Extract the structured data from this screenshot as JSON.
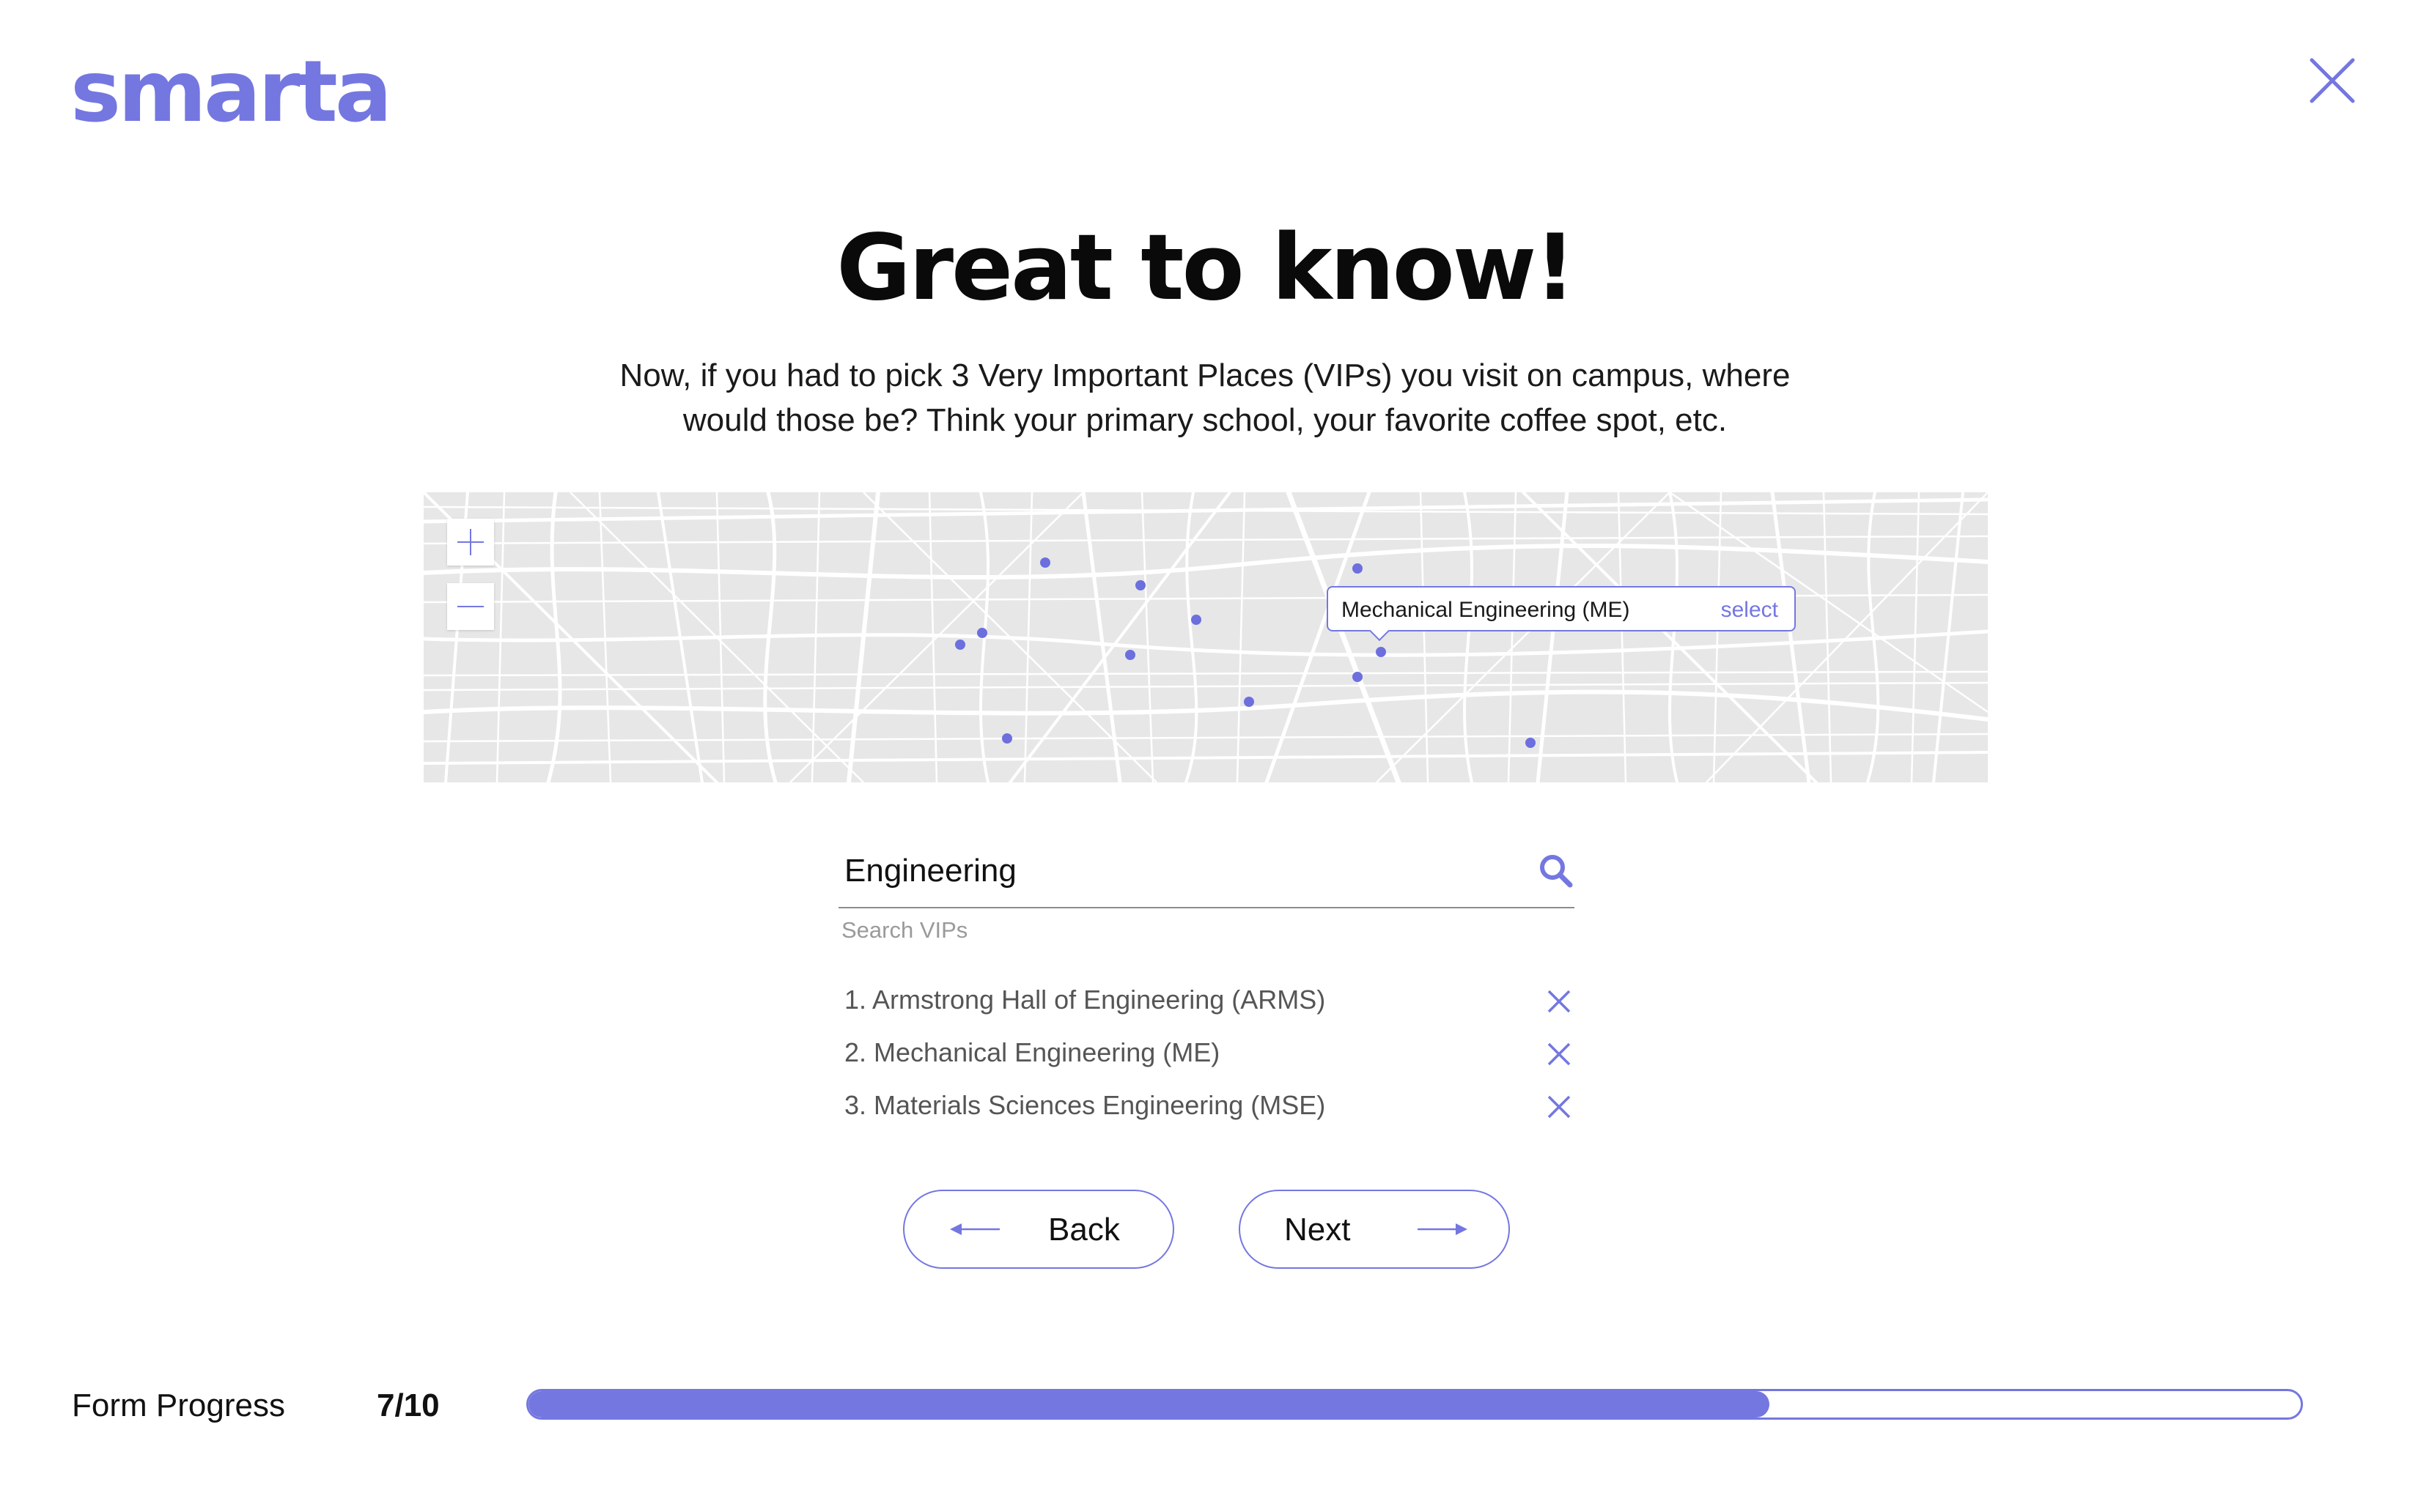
{
  "brand": {
    "logo_text": "smarta",
    "accent_color": "#7477e0"
  },
  "header": {
    "close_icon": "close-icon"
  },
  "main": {
    "title": "Great to know!",
    "subtitle_line1": "Now, if you had to pick 3 Very Important Places (VIPs) you visit on campus, where",
    "subtitle_line2": "would those be? Think your primary school, your favorite coffee spot, etc."
  },
  "map": {
    "zoom_in_icon": "plus-icon",
    "zoom_out_icon": "minus-icon",
    "popup": {
      "name": "Mechanical Engineering (ME)",
      "action": "select"
    }
  },
  "search": {
    "value": "Engineering",
    "caption": "Search VIPs",
    "icon": "search-icon"
  },
  "vips": [
    {
      "label": "1. Armstrong Hall of Engineering (ARMS)"
    },
    {
      "label": "2. Mechanical Engineering (ME)"
    },
    {
      "label": "3. Materials Sciences Engineering (MSE)"
    }
  ],
  "nav": {
    "back_label": "Back",
    "next_label": "Next"
  },
  "progress": {
    "label": "Form Progress",
    "count": "7/10",
    "current": 7,
    "total": 10
  }
}
